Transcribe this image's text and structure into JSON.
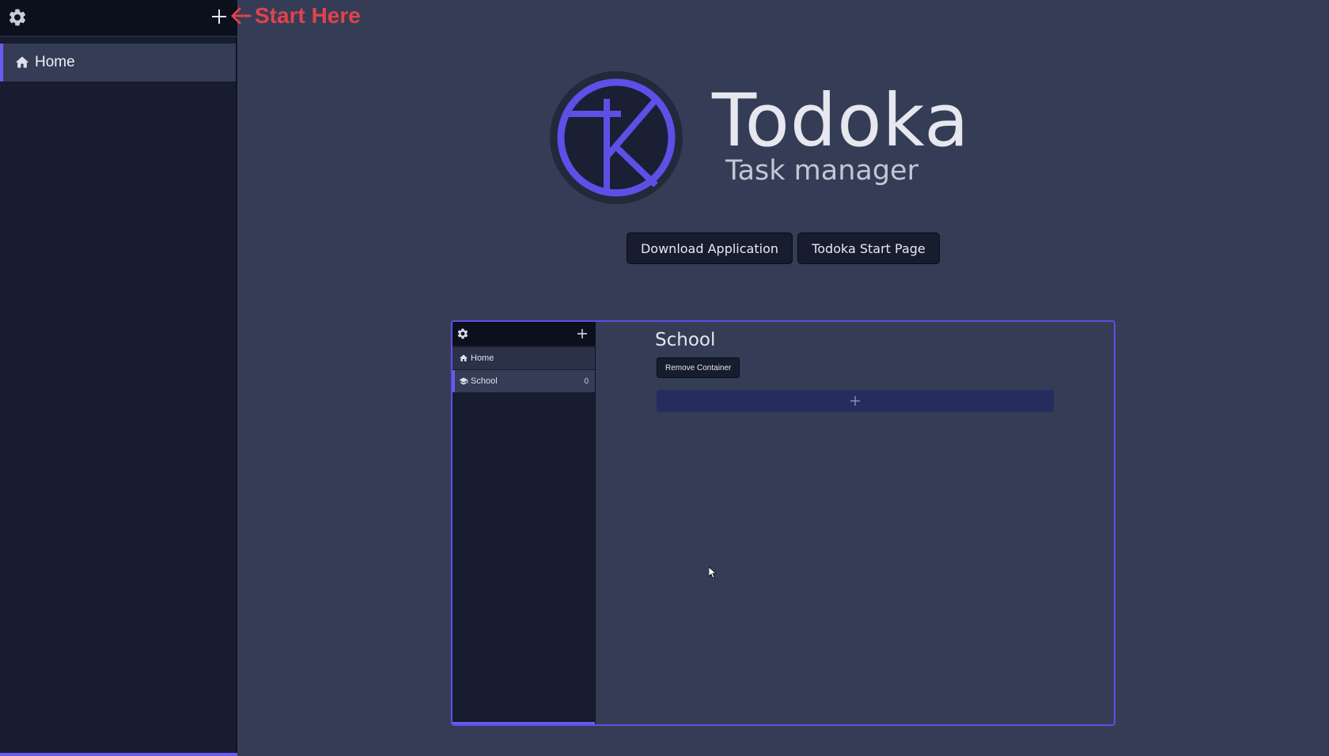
{
  "sidebar": {
    "items": [
      {
        "label": "Home",
        "icon": "home-icon",
        "active": true
      }
    ],
    "settings_icon": "gear-icon",
    "add_icon": "plus-icon"
  },
  "annotation": {
    "text": "Start Here",
    "icon": "arrow-left-icon",
    "color": "#e0434b"
  },
  "hero": {
    "title": "Todoka",
    "subtitle": "Task manager",
    "logo_icon": "todoka-logo",
    "buttons": [
      {
        "label": "Download Application"
      },
      {
        "label": "Todoka Start Page"
      }
    ]
  },
  "preview": {
    "sidebar": {
      "items": [
        {
          "label": "Home",
          "icon": "home-icon",
          "count": ""
        },
        {
          "label": "School",
          "icon": "graduation-cap-icon",
          "count": "0"
        }
      ]
    },
    "heading": "School",
    "remove_label": "Remove Container",
    "add_icon": "plus-icon"
  },
  "colors": {
    "accent": "#6a5cf0",
    "background": "#353c56",
    "sidebar": "#171c2e",
    "topbar": "#0c0f1c"
  }
}
